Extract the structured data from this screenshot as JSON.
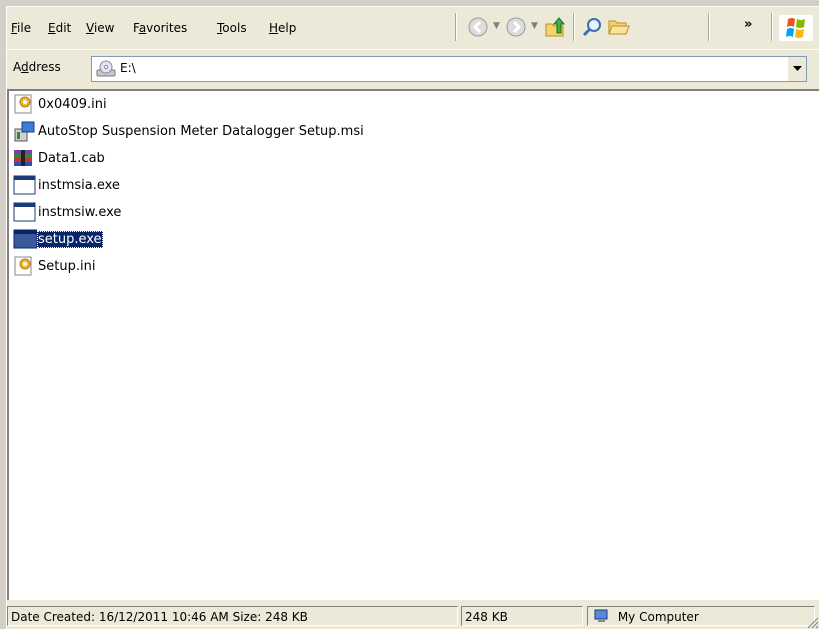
{
  "menu": {
    "items": [
      {
        "label_pre": "",
        "label_u": "F",
        "label_post": "ile"
      },
      {
        "label_pre": "",
        "label_u": "E",
        "label_post": "dit"
      },
      {
        "label_pre": "",
        "label_u": "V",
        "label_post": "iew"
      },
      {
        "label_pre": "F",
        "label_u": "a",
        "label_post": "vorites"
      },
      {
        "label_pre": "",
        "label_u": "T",
        "label_post": "ools"
      },
      {
        "label_pre": "",
        "label_u": "H",
        "label_post": "elp"
      }
    ],
    "chevron": "»"
  },
  "toolbar": {
    "icons": [
      "back-icon",
      "forward-icon",
      "up-folder-icon",
      "search-icon",
      "folders-icon"
    ]
  },
  "address": {
    "label_pre": "A",
    "label_u": "d",
    "label_post": "dress",
    "value": "E:\\",
    "icon": "cd-drive-icon"
  },
  "files": [
    {
      "name": "0x0409.ini",
      "icon": "ini-file-icon",
      "selected": false
    },
    {
      "name": "AutoStop Suspension Meter Datalogger Setup.msi",
      "icon": "msi-installer-icon",
      "selected": false
    },
    {
      "name": "Data1.cab",
      "icon": "cab-archive-icon",
      "selected": false
    },
    {
      "name": "instmsia.exe",
      "icon": "exe-window-icon",
      "selected": false
    },
    {
      "name": "instmsiw.exe",
      "icon": "exe-window-icon",
      "selected": false
    },
    {
      "name": "setup.exe",
      "icon": "exe-window-icon",
      "selected": true
    },
    {
      "name": "Setup.ini",
      "icon": "ini-file-icon",
      "selected": false
    }
  ],
  "status": {
    "details": "Date Created: 16/12/2011 10:46 AM Size: 248 KB",
    "size": "248 KB",
    "zone": "My Computer",
    "zone_icon": "my-computer-icon"
  },
  "colors": {
    "selection": "#0a246a",
    "chrome": "#ece9d8"
  }
}
